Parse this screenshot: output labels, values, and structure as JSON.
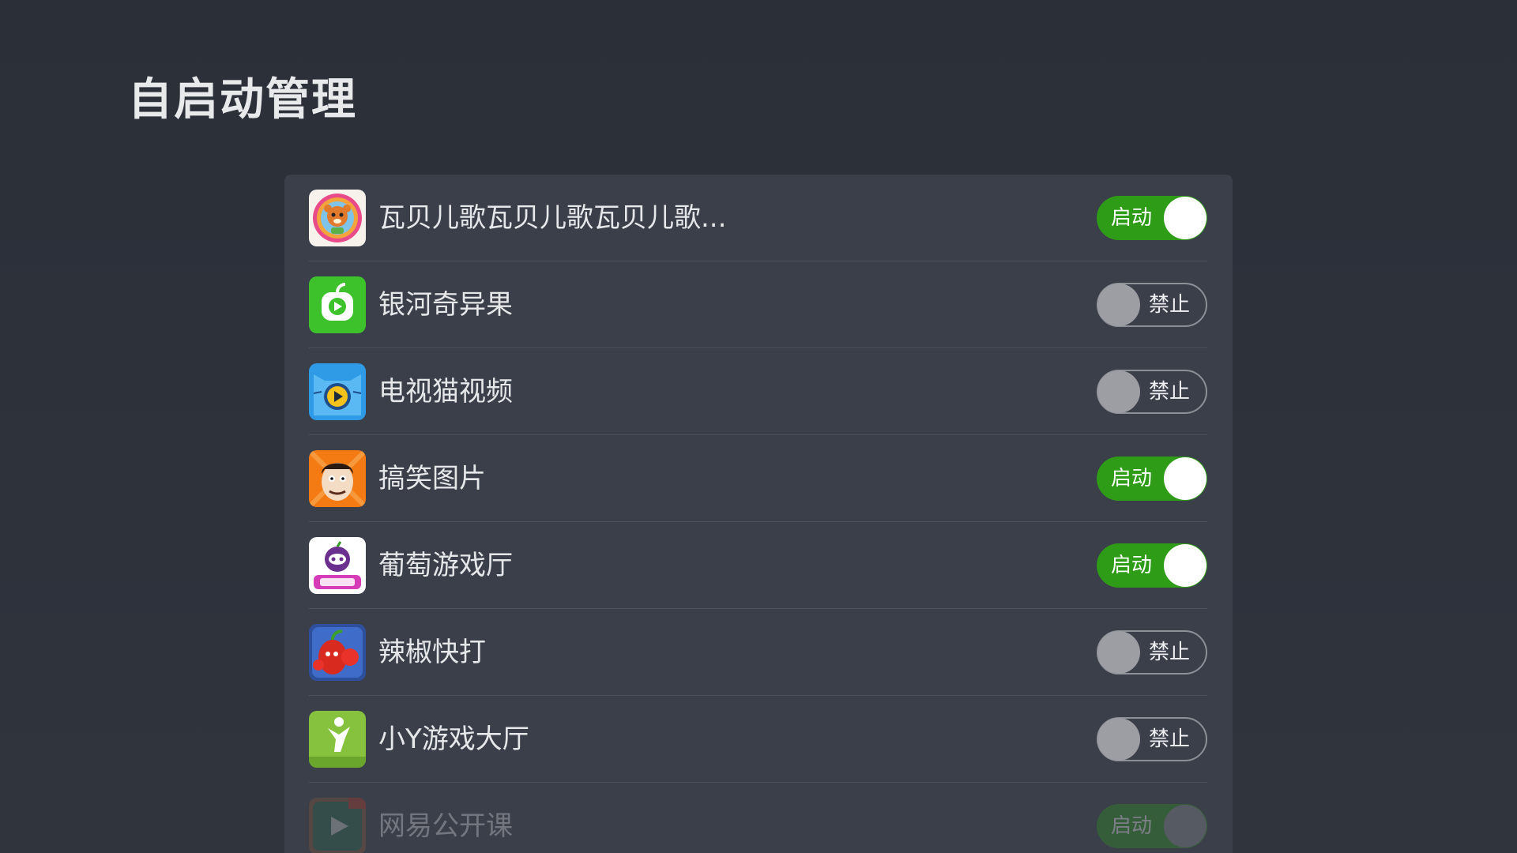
{
  "header": {
    "title": "自启动管理"
  },
  "colors": {
    "background": "#2c313b",
    "panel": "#3a3f4a",
    "toggle_on": "#2e9c17",
    "toggle_off_border": "#8d9097",
    "divider": "#4c515c"
  },
  "apps": [
    {
      "name": "瓦贝儿歌瓦贝儿歌瓦贝儿歌...",
      "icon": "wabei-kids-songs-icon",
      "state": "启动",
      "enabled": true
    },
    {
      "name": "银河奇异果",
      "icon": "yinhe-kiwi-icon",
      "state": "禁止",
      "enabled": false
    },
    {
      "name": "电视猫视频",
      "icon": "tv-cat-video-icon",
      "state": "禁止",
      "enabled": false
    },
    {
      "name": "搞笑图片",
      "icon": "funny-pictures-icon",
      "state": "启动",
      "enabled": true
    },
    {
      "name": "葡萄游戏厅",
      "icon": "grape-game-hall-icon",
      "state": "启动",
      "enabled": true
    },
    {
      "name": "辣椒快打",
      "icon": "chili-fighter-icon",
      "state": "禁止",
      "enabled": false
    },
    {
      "name": "小Y游戏大厅",
      "icon": "xiaoy-game-hall-icon",
      "state": "禁止",
      "enabled": false
    },
    {
      "name": "网易公开课",
      "icon": "netease-open-course-icon",
      "state": "启动",
      "enabled": true
    }
  ]
}
